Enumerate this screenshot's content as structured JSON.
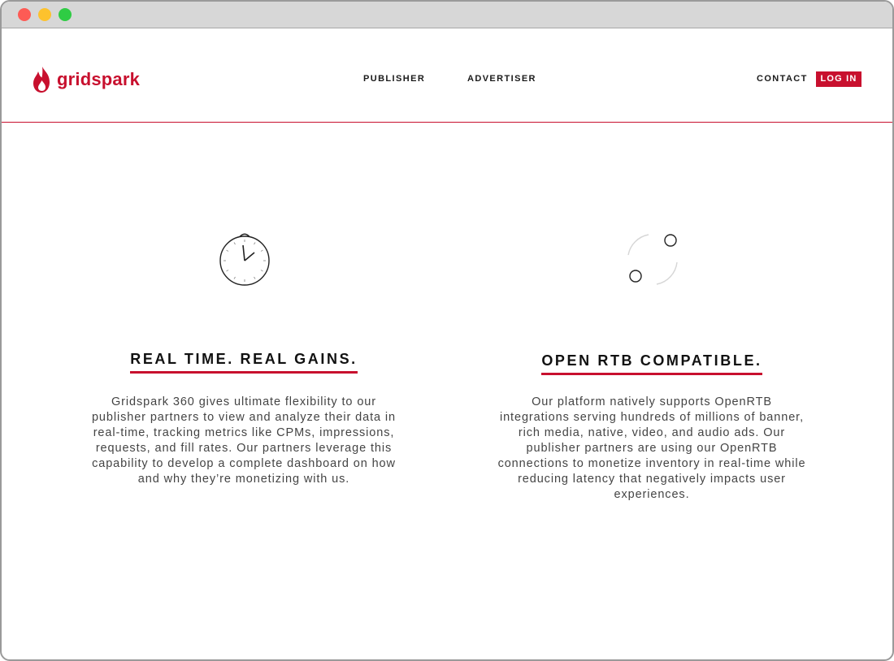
{
  "brand": {
    "name": "gridspark",
    "color": "#c8102e"
  },
  "nav": {
    "publisher": "PUBLISHER",
    "advertiser": "ADVERTISER",
    "contact": "CONTACT",
    "login": "LOG IN"
  },
  "features": [
    {
      "icon": "stopwatch-icon",
      "title": "REAL TIME. REAL GAINS.",
      "body": "Gridspark 360 gives ultimate flexibility to our publisher partners to view and analyze their data in real-time, tracking metrics like CPMs, impressions, requests, and fill rates. Our partners leverage this capability to develop a complete dashboard on how and why they’re monetizing with us."
    },
    {
      "icon": "sync-circles-icon",
      "title": "OPEN RTB COMPATIBLE.",
      "body": "Our platform natively supports OpenRTB integrations serving hundreds of millions of banner, rich media, native, video, and audio ads. Our publisher partners are using our OpenRTB connections to monetize inventory in real-time while reducing latency that negatively impacts user experiences."
    }
  ]
}
